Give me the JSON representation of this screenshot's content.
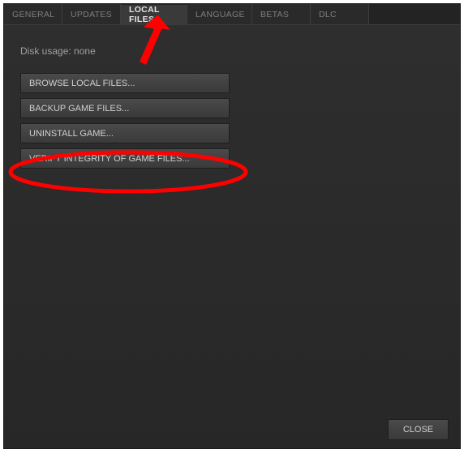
{
  "tabs": [
    {
      "label": "GENERAL",
      "active": false
    },
    {
      "label": "UPDATES",
      "active": false
    },
    {
      "label": "LOCAL FILES",
      "active": true
    },
    {
      "label": "LANGUAGE",
      "active": false
    },
    {
      "label": "BETAS",
      "active": false
    },
    {
      "label": "DLC",
      "active": false
    }
  ],
  "disk_usage": {
    "label": "Disk usage:",
    "value": "none"
  },
  "buttons": {
    "browse": "BROWSE LOCAL FILES...",
    "backup": "BACKUP GAME FILES...",
    "uninstall": "UNINSTALL GAME...",
    "verify": "VERIFY INTEGRITY OF GAME FILES..."
  },
  "footer": {
    "close": "CLOSE"
  },
  "annotations": {
    "arrow_color": "#ff0000",
    "circle_color": "#ff0000"
  }
}
